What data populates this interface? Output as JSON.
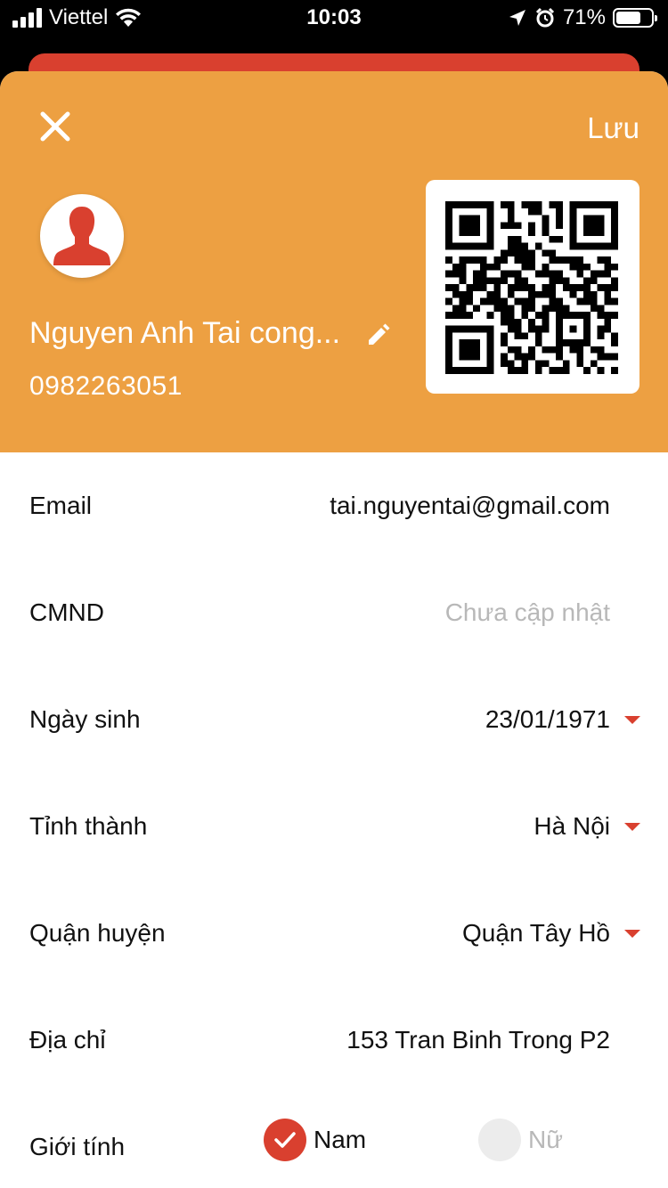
{
  "status_bar": {
    "carrier": "Viettel",
    "time": "10:03",
    "battery_percent": "71%",
    "battery_level": 0.71
  },
  "header": {
    "save_label": "Lưu",
    "user_name": "Nguyen Anh Tai cong...",
    "phone": "0982263051",
    "background_color": "#eda042"
  },
  "accent_color": "#d9402f",
  "fields": [
    {
      "label": "Email",
      "value": "tai.nguyentai@gmail.com"
    },
    {
      "label": "CMND",
      "placeholder": "Chưa cập nhật"
    },
    {
      "label": "Ngày sinh",
      "value": "23/01/1971"
    },
    {
      "label": "Tỉnh thành",
      "value": "Hà Nội"
    },
    {
      "label": "Quận huyện",
      "value": "Quận Tây Hồ"
    },
    {
      "label": "Địa chỉ",
      "value": "153 Tran Binh Trong P2"
    }
  ],
  "gender": {
    "label": "Giới tính",
    "options": [
      {
        "label": "Nam",
        "selected": true
      },
      {
        "label": "Nữ",
        "selected": false
      }
    ]
  }
}
